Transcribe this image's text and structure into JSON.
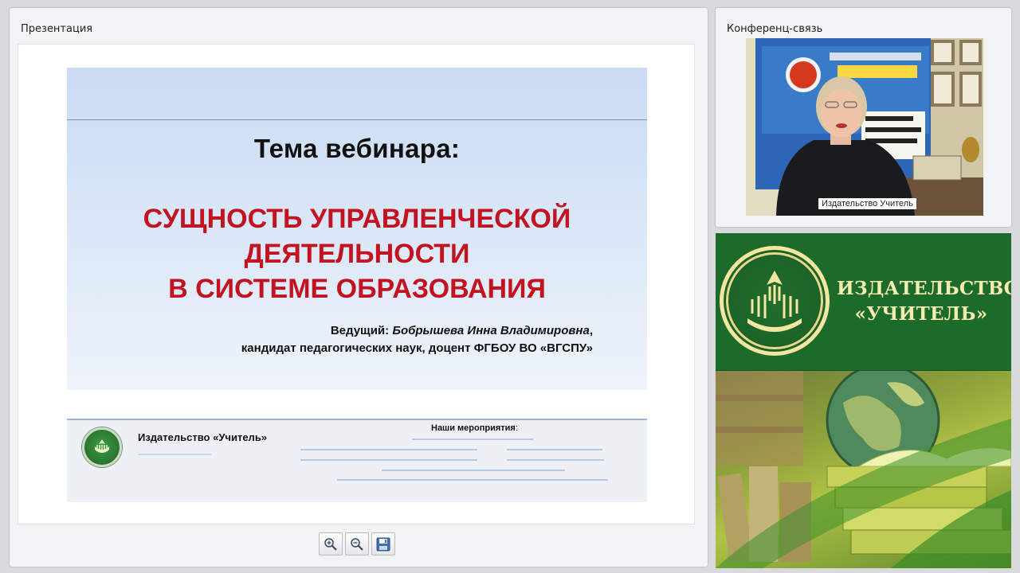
{
  "presentation_panel": {
    "title": "Презентация"
  },
  "slide": {
    "title": "Тема вебинара:",
    "headline": [
      "СУЩНОСТЬ  УПРАВЛЕНЧЕСКОЙ",
      "ДЕЯТЕЛЬНОСТИ",
      "В СИСТЕМЕ  ОБРАЗОВАНИЯ"
    ],
    "presenter_label": "Ведущий:",
    "presenter_name": "Бобрышева Инна Владимировна",
    "presenter_name_suffix": ",",
    "presenter_credentials": "кандидат педагогических наук, доцент ФГБОУ ВО «ВГСПУ»",
    "footer_brand": "Издательство «Учитель»",
    "events_title": "Наши мероприятия",
    "events_colon": ":"
  },
  "toolbar": {
    "zoom_in_icon": "zoom-in-icon",
    "zoom_out_icon": "zoom-out-icon",
    "save_icon": "save-icon"
  },
  "conference_panel": {
    "title": "Конференц-связь",
    "video_caption": "Издательство Учитель"
  },
  "publisher_banner": {
    "name_line1": "ИЗДАТЕЛЬСТВО",
    "name_line2": "«УЧИТЕЛЬ»"
  },
  "colors": {
    "headline_red": "#c41320",
    "banner_green": "#1c6b2a",
    "banner_gold": "#f7ecb0"
  }
}
